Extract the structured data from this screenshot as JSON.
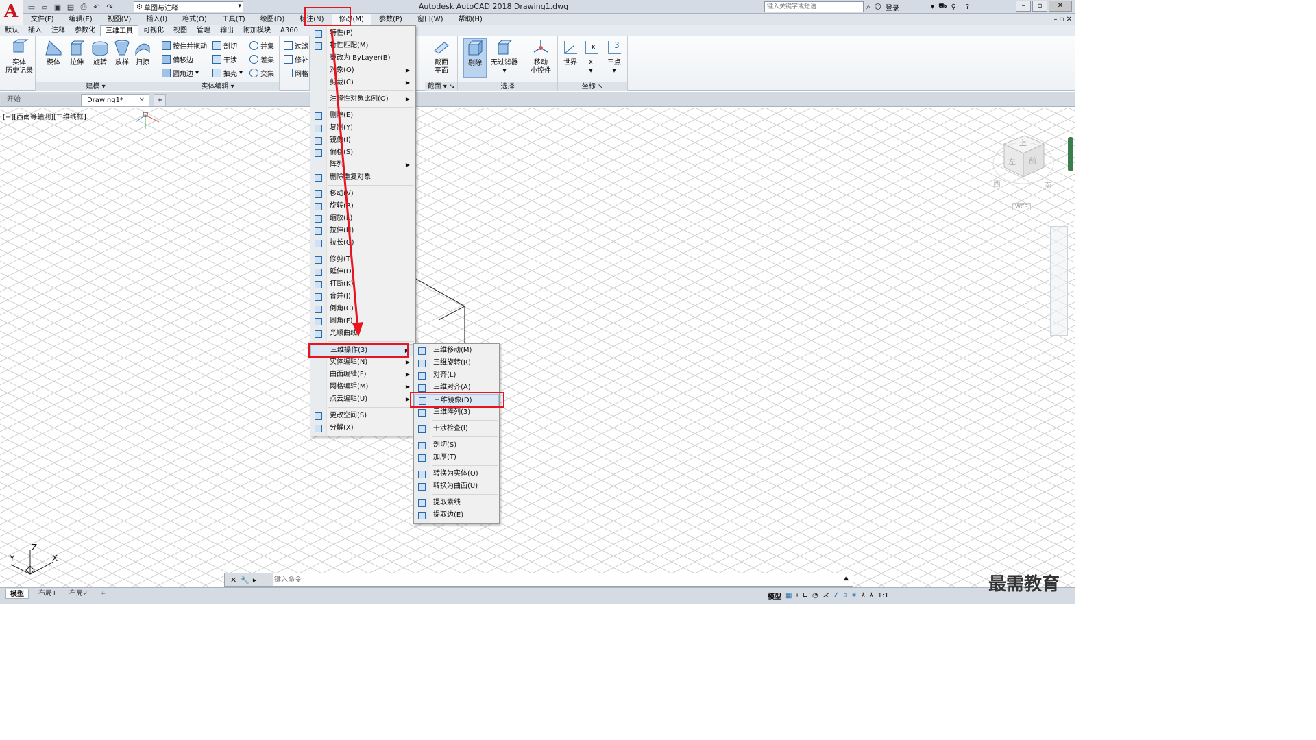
{
  "titlebar": {
    "title": "Autodesk AutoCAD 2018    Drawing1.dwg",
    "workspace": "草图与注释",
    "search_placeholder": "键入关键字或短语",
    "login": "登录"
  },
  "menubar": {
    "items": [
      "文件(F)",
      "编辑(E)",
      "视图(V)",
      "插入(I)",
      "格式(O)",
      "工具(T)",
      "绘图(D)",
      "标注(N)",
      "修改(M)",
      "参数(P)",
      "窗口(W)",
      "帮助(H)"
    ]
  },
  "ribbon_tabs": [
    "默认",
    "插入",
    "注释",
    "参数化",
    "三维工具",
    "可视化",
    "视图",
    "管理",
    "输出",
    "附加模块",
    "A360"
  ],
  "ribbon": {
    "history": {
      "label1": "实体",
      "label2": "历史记录"
    },
    "modeling": {
      "title": "建模",
      "buttons": [
        "楔体",
        "拉伸",
        "旋转",
        "放样",
        "扫掠"
      ]
    },
    "solid_edit": {
      "title": "实体编辑",
      "small": [
        "按住并拖动",
        "剖切",
        "并集",
        "偏移边",
        "干涉",
        "差集",
        "圆角边",
        "抽壳",
        "交集"
      ]
    },
    "next_small": [
      "过滤",
      "修补",
      "网格"
    ],
    "section": {
      "title": "截面",
      "label1": "截面",
      "label2": "平面"
    },
    "selection": {
      "title": "选择",
      "culling": "剔除",
      "nofilter": "无过滤器",
      "move1": "移动",
      "move2": "小控件"
    },
    "coords": {
      "title": "坐标",
      "world": "世界",
      "x": "X",
      "three": "三点"
    }
  },
  "doctabs": {
    "start": "开始",
    "drawing": "Drawing1*"
  },
  "viewport_label": "[−][西南等轴测][二维线框]",
  "modify_menu": [
    {
      "label": "特性(P)",
      "icon": "properties-icon",
      "arrow": false
    },
    {
      "label": "特性匹配(M)",
      "icon": "match-properties-icon",
      "arrow": false
    },
    {
      "label": "更改为 ByLayer(B)",
      "icon": "",
      "arrow": false
    },
    {
      "label": "对象(O)",
      "icon": "",
      "arrow": true
    },
    {
      "label": "剪裁(C)",
      "icon": "",
      "arrow": true
    },
    {
      "label": "注释性对象比例(O)",
      "icon": "",
      "arrow": true
    },
    {
      "label": "删除(E)",
      "icon": "erase-icon",
      "arrow": false
    },
    {
      "label": "复制(Y)",
      "icon": "copy-icon",
      "arrow": false
    },
    {
      "label": "镜像(I)",
      "icon": "mirror-icon",
      "arrow": false
    },
    {
      "label": "偏移(S)",
      "icon": "offset-icon",
      "arrow": false
    },
    {
      "label": "阵列",
      "icon": "",
      "arrow": true
    },
    {
      "label": "删除重复对象",
      "icon": "overkill-icon",
      "arrow": false
    },
    {
      "label": "移动(V)",
      "icon": "move-icon",
      "arrow": false
    },
    {
      "label": "旋转(R)",
      "icon": "rotate-icon",
      "arrow": false
    },
    {
      "label": "缩放(L)",
      "icon": "scale-icon",
      "arrow": false
    },
    {
      "label": "拉伸(H)",
      "icon": "stretch-icon",
      "arrow": false
    },
    {
      "label": "拉长(G)",
      "icon": "lengthen-icon",
      "arrow": false
    },
    {
      "label": "修剪(T)",
      "icon": "trim-icon",
      "arrow": false
    },
    {
      "label": "延伸(D)",
      "icon": "extend-icon",
      "arrow": false
    },
    {
      "label": "打断(K)",
      "icon": "break-icon",
      "arrow": false
    },
    {
      "label": "合并(J)",
      "icon": "join-icon",
      "arrow": false
    },
    {
      "label": "倒角(C)",
      "icon": "chamfer-icon",
      "arrow": false
    },
    {
      "label": "圆角(F)",
      "icon": "fillet-icon",
      "arrow": false
    },
    {
      "label": "光顺曲线",
      "icon": "blend-icon",
      "arrow": false
    },
    {
      "label": "三维操作(3)",
      "icon": "",
      "arrow": true
    },
    {
      "label": "实体编辑(N)",
      "icon": "",
      "arrow": true
    },
    {
      "label": "曲面编辑(F)",
      "icon": "",
      "arrow": true
    },
    {
      "label": "网格编辑(M)",
      "icon": "",
      "arrow": true
    },
    {
      "label": "点云编辑(U)",
      "icon": "",
      "arrow": true
    },
    {
      "label": "更改空间(S)",
      "icon": "change-space-icon",
      "arrow": false
    },
    {
      "label": "分解(X)",
      "icon": "explode-icon",
      "arrow": false
    }
  ],
  "ops3d_menu": [
    {
      "label": "三维移动(M)",
      "icon": "3dmove-icon"
    },
    {
      "label": "三维旋转(R)",
      "icon": "3drotate-icon"
    },
    {
      "label": "对齐(L)",
      "icon": "align-icon"
    },
    {
      "label": "三维对齐(A)",
      "icon": "3dalign-icon"
    },
    {
      "label": "三维镜像(D)",
      "icon": "3dmirror-icon"
    },
    {
      "label": "三维阵列(3)",
      "icon": "3darray-icon"
    },
    {
      "label": "干涉检查(I)",
      "icon": "interference-icon"
    },
    {
      "label": "剖切(S)",
      "icon": "slice-icon"
    },
    {
      "label": "加厚(T)",
      "icon": "thicken-icon"
    },
    {
      "label": "转换为实体(O)",
      "icon": "convert-solid-icon"
    },
    {
      "label": "转换为曲面(U)",
      "icon": "convert-surface-icon"
    },
    {
      "label": "提取素线",
      "icon": "extract-isolines-icon"
    },
    {
      "label": "提取边(E)",
      "icon": "extract-edges-icon"
    }
  ],
  "cmdline": {
    "placeholder": "键入命令"
  },
  "statusbar": {
    "model": "模型",
    "layout1": "布局1",
    "layout2": "布局2",
    "plus": "+",
    "model_right": "模型",
    "scale": "1:1"
  },
  "viewcube": {
    "top": "上",
    "left": "左",
    "front": "前",
    "west": "西",
    "south": "南",
    "wcs": "WCS"
  },
  "ucs": {
    "x": "X",
    "y": "Y",
    "z": "Z"
  },
  "watermark": "最需教育",
  "colors": {
    "accent": "#e8141e",
    "menu_bg": "#f0f0f0",
    "highlight": "#dde8f5"
  }
}
